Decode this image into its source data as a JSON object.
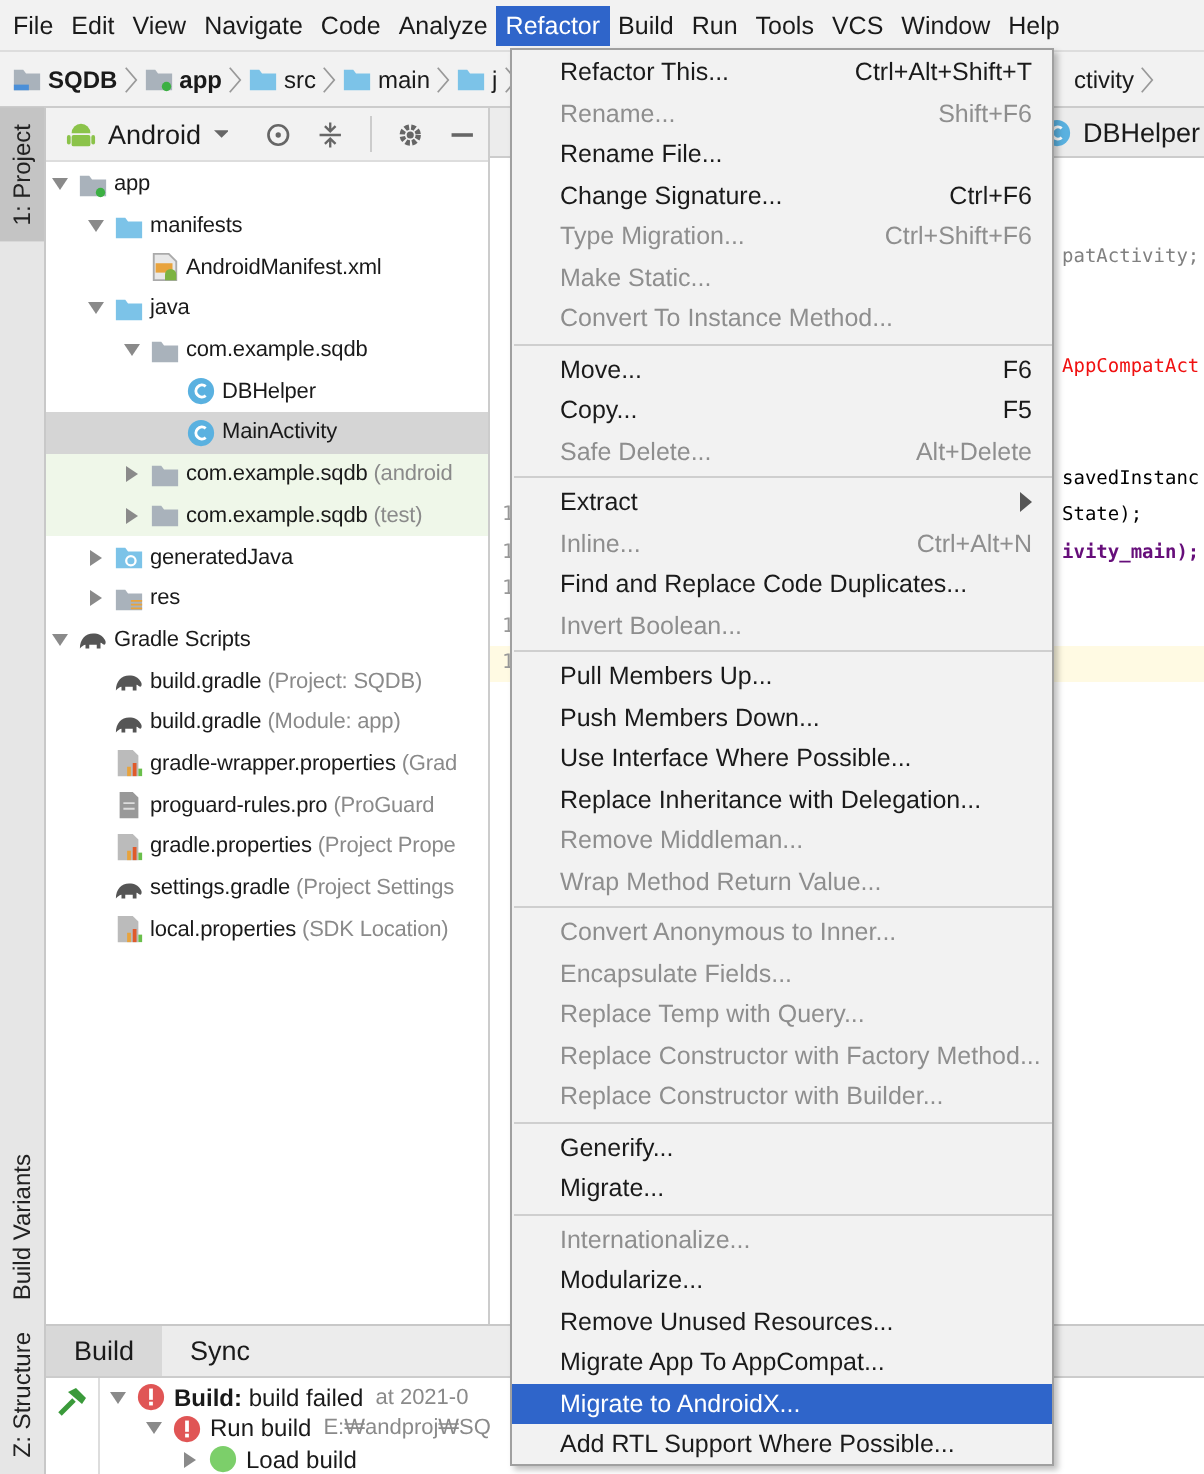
{
  "menu_bar": [
    {
      "label": "File",
      "selected": false
    },
    {
      "label": "Edit",
      "selected": false
    },
    {
      "label": "View",
      "selected": false
    },
    {
      "label": "Navigate",
      "selected": false
    },
    {
      "label": "Code",
      "selected": false
    },
    {
      "label": "Analyze",
      "selected": false
    },
    {
      "label": "Refactor",
      "selected": true
    },
    {
      "label": "Build",
      "selected": false
    },
    {
      "label": "Run",
      "selected": false
    },
    {
      "label": "Tools",
      "selected": false
    },
    {
      "label": "VCS",
      "selected": false
    },
    {
      "label": "Window",
      "selected": false
    },
    {
      "label": "Help",
      "selected": false
    }
  ],
  "breadcrumbs": [
    {
      "label": "SQDB",
      "kind": "project"
    },
    {
      "label": "app",
      "kind": "module"
    },
    {
      "label": "src",
      "kind": "folder"
    },
    {
      "label": "main",
      "kind": "folder"
    },
    {
      "label": "j",
      "kind": "source"
    },
    {
      "label": "ctivity",
      "kind": "class"
    }
  ],
  "left_tool_strip": {
    "top": [
      {
        "label": "1: Project",
        "selected": true
      }
    ],
    "bottom": [
      {
        "label": "Build Variants",
        "selected": false
      },
      {
        "label": "Z: Structure",
        "selected": false
      }
    ]
  },
  "project": {
    "view": "Android",
    "tree": [
      {
        "label": "app",
        "kind": "module",
        "expanded": true,
        "selected": false,
        "children": [
          {
            "label": "manifests",
            "kind": "folder",
            "expanded": true,
            "selected": false,
            "children": [
              {
                "label": "AndroidManifest.xml",
                "kind": "manifest",
                "selected": false
              }
            ]
          },
          {
            "label": "java",
            "kind": "folder",
            "expanded": true,
            "selected": false,
            "children": [
              {
                "label": "com.example.sqdb",
                "kind": "package",
                "expanded": true,
                "selected": false,
                "test_source": false,
                "children": [
                  {
                    "label": "DBHelper",
                    "kind": "class",
                    "selected": false
                  },
                  {
                    "label": "MainActivity",
                    "kind": "class",
                    "selected": true
                  }
                ]
              },
              {
                "label": "com.example.sqdb",
                "hint": "(android",
                "kind": "package",
                "expanded": false,
                "selected": false,
                "test_source": true
              },
              {
                "label": "com.example.sqdb",
                "hint": "(test)",
                "kind": "package",
                "expanded": false,
                "selected": false,
                "test_source": true
              }
            ]
          },
          {
            "label": "generatedJava",
            "kind": "generated",
            "expanded": false,
            "selected": false
          },
          {
            "label": "res",
            "kind": "res",
            "expanded": false,
            "selected": false
          }
        ]
      },
      {
        "label": "Gradle Scripts",
        "kind": "gradle",
        "expanded": true,
        "selected": false,
        "children": [
          {
            "label": "build.gradle",
            "hint": "(Project: SQDB)",
            "kind": "gradle",
            "selected": false
          },
          {
            "label": "build.gradle",
            "hint": "(Module: app)",
            "kind": "gradle",
            "selected": false
          },
          {
            "label": "gradle-wrapper.properties",
            "hint": "(Grad",
            "kind": "properties",
            "selected": false
          },
          {
            "label": "proguard-rules.pro",
            "hint": "(ProGuard",
            "kind": "proguard",
            "selected": false
          },
          {
            "label": "gradle.properties",
            "hint": "(Project Prope",
            "kind": "properties",
            "selected": false
          },
          {
            "label": "settings.gradle",
            "hint": "(Project Settings",
            "kind": "gradle",
            "selected": false
          },
          {
            "label": "local.properties",
            "hint": "(SDK Location)",
            "kind": "properties",
            "selected": false
          }
        ]
      }
    ]
  },
  "editor": {
    "tabs": [
      {
        "label": "DBHelper",
        "selected": false
      }
    ],
    "lines": [
      {
        "current": false
      },
      {
        "current": false
      },
      {
        "text": "patActivity;",
        "kind": "unused",
        "current": false
      },
      {
        "current": false
      },
      {
        "current": false
      },
      {
        "text": "AppCompatAct",
        "kind": "error",
        "current": false
      },
      {
        "current": false
      },
      {
        "current": false
      },
      {
        "text": "savedInstanc",
        "kind": "plain",
        "current": false
      },
      {
        "number": "1",
        "text": "State);",
        "kind": "plain",
        "current": false
      },
      {
        "number": "1",
        "text": "ivity_main);",
        "kind": "field",
        "current": false
      },
      {
        "number": "1",
        "current": false
      },
      {
        "number": "1",
        "current": false
      },
      {
        "number": "1",
        "current": true
      }
    ]
  },
  "refactor_menu": [
    [
      {
        "label": "Refactor This...",
        "shortcut": "Ctrl+Alt+Shift+T",
        "disabled": false,
        "selected": false
      },
      {
        "label": "Rename...",
        "shortcut": "Shift+F6",
        "disabled": true,
        "selected": false
      },
      {
        "label": "Rename File...",
        "disabled": false,
        "selected": false
      },
      {
        "label": "Change Signature...",
        "shortcut": "Ctrl+F6",
        "disabled": false,
        "selected": false
      },
      {
        "label": "Type Migration...",
        "shortcut": "Ctrl+Shift+F6",
        "disabled": true,
        "selected": false
      },
      {
        "label": "Make Static...",
        "disabled": true,
        "selected": false
      },
      {
        "label": "Convert To Instance Method...",
        "disabled": true,
        "selected": false
      }
    ],
    [
      {
        "label": "Move...",
        "shortcut": "F6",
        "disabled": false,
        "selected": false
      },
      {
        "label": "Copy...",
        "shortcut": "F5",
        "disabled": false,
        "selected": false
      },
      {
        "label": "Safe Delete...",
        "shortcut": "Alt+Delete",
        "disabled": true,
        "selected": false
      }
    ],
    [
      {
        "label": "Extract",
        "submenu": true,
        "disabled": false,
        "selected": false
      },
      {
        "label": "Inline...",
        "shortcut": "Ctrl+Alt+N",
        "disabled": true,
        "selected": false
      },
      {
        "label": "Find and Replace Code Duplicates...",
        "disabled": false,
        "selected": false
      },
      {
        "label": "Invert Boolean...",
        "disabled": true,
        "selected": false
      }
    ],
    [
      {
        "label": "Pull Members Up...",
        "disabled": false,
        "selected": false
      },
      {
        "label": "Push Members Down...",
        "disabled": false,
        "selected": false
      },
      {
        "label": "Use Interface Where Possible...",
        "disabled": false,
        "selected": false
      },
      {
        "label": "Replace Inheritance with Delegation...",
        "disabled": false,
        "selected": false
      },
      {
        "label": "Remove Middleman...",
        "disabled": true,
        "selected": false
      },
      {
        "label": "Wrap Method Return Value...",
        "disabled": true,
        "selected": false
      }
    ],
    [
      {
        "label": "Convert Anonymous to Inner...",
        "disabled": true,
        "selected": false
      },
      {
        "label": "Encapsulate Fields...",
        "disabled": true,
        "selected": false
      },
      {
        "label": "Replace Temp with Query...",
        "disabled": true,
        "selected": false
      },
      {
        "label": "Replace Constructor with Factory Method...",
        "disabled": true,
        "selected": false
      },
      {
        "label": "Replace Constructor with Builder...",
        "disabled": true,
        "selected": false
      }
    ],
    [
      {
        "label": "Generify...",
        "disabled": false,
        "selected": false
      },
      {
        "label": "Migrate...",
        "disabled": false,
        "selected": false
      }
    ],
    [
      {
        "label": "Internationalize...",
        "disabled": true,
        "selected": false
      },
      {
        "label": "Modularize...",
        "disabled": false,
        "selected": false
      },
      {
        "label": "Remove Unused Resources...",
        "disabled": false,
        "selected": false
      },
      {
        "label": "Migrate App To AppCompat...",
        "disabled": false,
        "selected": false
      },
      {
        "label": "Migrate to AndroidX...",
        "disabled": false,
        "selected": true
      },
      {
        "label": "Add RTL Support Where Possible...",
        "disabled": false,
        "selected": false
      }
    ]
  ],
  "build_panel": {
    "tabs": [
      {
        "label": "Build",
        "selected": true
      },
      {
        "label": "Sync",
        "selected": false
      }
    ],
    "tree": [
      {
        "label": "**Build:** build failed",
        "detail": "at 2021-0",
        "kind": "error",
        "expanded": true,
        "children": [
          {
            "label": "Run build",
            "detail": "E:₩andproj₩SQ",
            "kind": "error",
            "expanded": true,
            "children": [
              {
                "label": "Load build",
                "kind": "ok",
                "expanded": false
              }
            ]
          }
        ]
      }
    ]
  }
}
